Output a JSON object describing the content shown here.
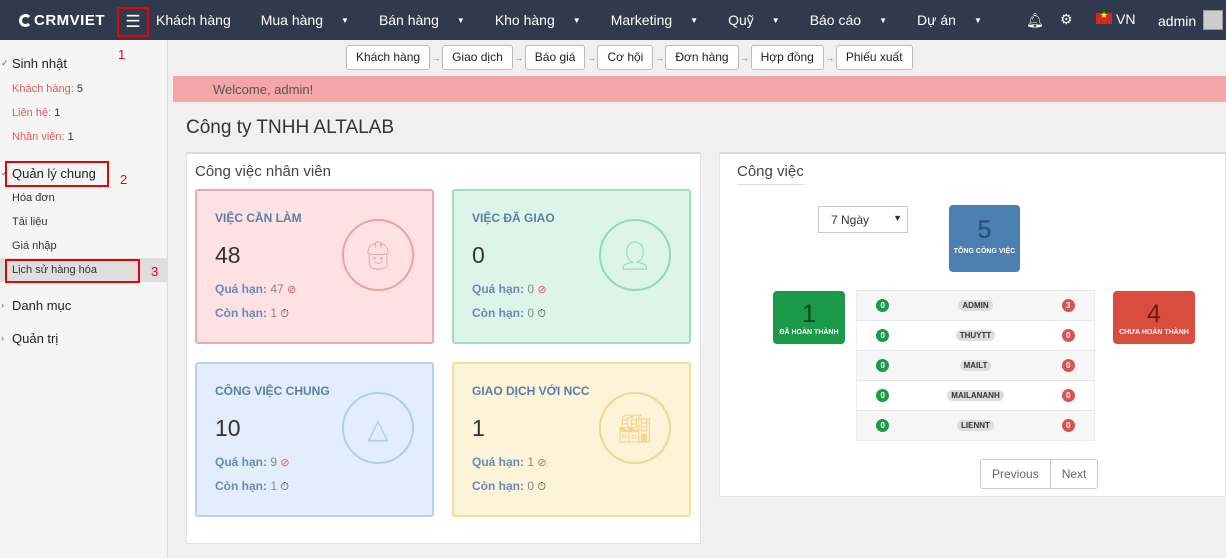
{
  "topbar": {
    "logo": "CRMVIET",
    "menu": [
      {
        "label": "Khách hàng",
        "caret": false
      },
      {
        "label": "Mua hàng",
        "caret": true
      },
      {
        "label": "Bán hàng",
        "caret": true
      },
      {
        "label": "Kho hàng",
        "caret": true
      },
      {
        "label": "Marketing",
        "caret": true
      },
      {
        "label": "Quỹ",
        "caret": true
      },
      {
        "label": "Báo cáo",
        "caret": true
      },
      {
        "label": "Dự án",
        "caret": true
      }
    ],
    "language": "VN",
    "user": "admin"
  },
  "sidebar": {
    "birthday": {
      "title": "Sinh nhật",
      "items": [
        {
          "label": "Khách hàng:",
          "count": "5"
        },
        {
          "label": "Liên hệ:",
          "count": "1"
        },
        {
          "label": "Nhân viên:",
          "count": "1"
        }
      ]
    },
    "general": {
      "title": "Quản lý chung",
      "items": [
        "Hóa đơn",
        "Tài liệu",
        "Giá nhập",
        "Lịch sử hàng hóa"
      ]
    },
    "catalog": "Danh mục",
    "admin": "Quản trị"
  },
  "annotations": [
    "1",
    "2",
    "3"
  ],
  "steps": [
    "Khách hàng",
    "Giao dịch",
    "Báo giá",
    "Cơ hội",
    "Đơn hàng",
    "Hợp đồng",
    "Phiếu xuất"
  ],
  "welcome": "Welcome, admin!",
  "company": "Công ty TNHH ALTALAB",
  "staff_panel": {
    "title": "Công việc nhân viên",
    "overdue_label": "Quá hạn:",
    "remaining_label": "Còn hạn:",
    "cards": [
      {
        "title": "Việc cần làm",
        "value": "48",
        "overdue": "47",
        "remaining": "1",
        "icon": "worker-icon"
      },
      {
        "title": "Việc đã giao",
        "value": "0",
        "overdue": "0",
        "remaining": "0",
        "icon": "user-check-icon"
      },
      {
        "title": "Công việc chung",
        "value": "10",
        "overdue": "9",
        "remaining": "1",
        "icon": "network-icon"
      },
      {
        "title": "Giao dịch với NCC",
        "value": "1",
        "overdue": "1",
        "remaining": "0",
        "icon": "factory-icon"
      }
    ]
  },
  "work_panel": {
    "title": "Công việc",
    "period": "7 Ngày",
    "total": {
      "value": "5",
      "label": "TỔNG CÔNG VIỆC"
    },
    "done": {
      "value": "1",
      "label": "ĐÃ HOÀN THÀNH"
    },
    "not_done": {
      "value": "4",
      "label": "CHƯA HOÀN THÀNH"
    },
    "rows": [
      {
        "done": "0",
        "name": "ADMIN",
        "pending": "3"
      },
      {
        "done": "0",
        "name": "THUYTT",
        "pending": "0"
      },
      {
        "done": "0",
        "name": "MAILT",
        "pending": "0"
      },
      {
        "done": "0",
        "name": "MAILANANH",
        "pending": "0"
      },
      {
        "done": "0",
        "name": "LIENNT",
        "pending": "0"
      }
    ],
    "pager": {
      "prev": "Previous",
      "next": "Next"
    }
  },
  "colors": {
    "topbar": "#2f3b4c",
    "total": "#4a7fb0",
    "done": "#1a9a46",
    "not_done": "#d94d3f",
    "welcome": "#f4a6aa"
  }
}
